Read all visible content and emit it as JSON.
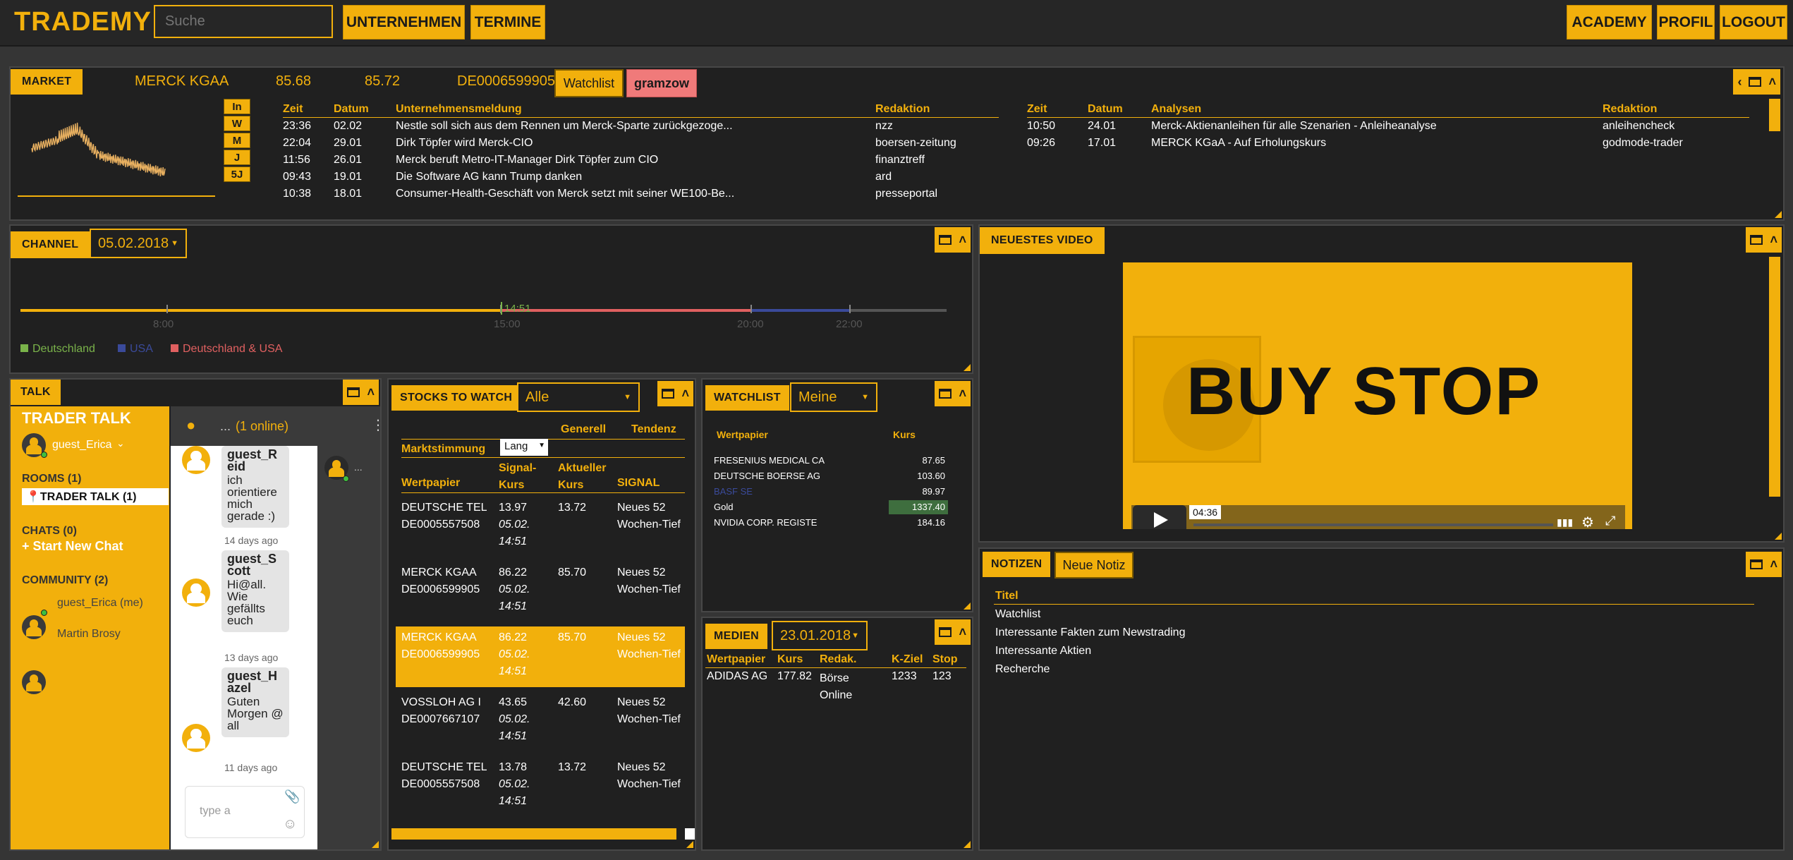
{
  "header": {
    "logo": "TRADEMY",
    "search_placeholder": "Suche",
    "nav_left": [
      "UNTERNEHMEN",
      "TERMINE"
    ],
    "nav_right": [
      "ACADEMY",
      "PROFIL",
      "LOGOUT"
    ]
  },
  "market": {
    "title": "MARKET",
    "name": "MERCK KGAA",
    "price1": "85.68",
    "price2": "85.72",
    "isin": "DE0006599905",
    "watchlist_btn": "Watchlist",
    "user_btn": "gramzow",
    "ranges": [
      "In",
      "W",
      "M",
      "J",
      "5J"
    ],
    "news_headers": [
      "Zeit",
      "Datum",
      "Unternehmensmeldung",
      "Redaktion"
    ],
    "news": [
      [
        "23:36",
        "02.02",
        "Nestle soll sich aus dem Rennen um Merck-Sparte zurückgezoge...",
        "nzz"
      ],
      [
        "22:04",
        "29.01",
        "Dirk Töpfer wird Merck-CIO",
        "boersen-zeitung"
      ],
      [
        "11:56",
        "26.01",
        "Merck beruft Metro-IT-Manager Dirk Töpfer zum CIO",
        "finanztreff"
      ],
      [
        "09:43",
        "19.01",
        "Die Software AG kann Trump danken",
        "ard"
      ],
      [
        "10:38",
        "18.01",
        "Consumer-Health-Geschäft von Merck setzt mit seiner WE100-Be...",
        "presseportal"
      ]
    ],
    "analysis_headers": [
      "Zeit",
      "Datum",
      "Analysen",
      "Redaktion"
    ],
    "analysis": [
      [
        "10:50",
        "24.01",
        "Merck-Aktienanleihen für alle Szenarien - Anleiheanalyse",
        "anleihencheck"
      ],
      [
        "09:26",
        "17.01",
        "MERCK KGaA - Auf Erholungskurs",
        "godmode-trader"
      ]
    ]
  },
  "channel": {
    "title": "CHANNEL",
    "date": "05.02.2018",
    "ticks": [
      "8:00",
      "15:00",
      "20:00",
      "22:00"
    ],
    "now": "14:51",
    "legend": [
      "Deutschland",
      "USA",
      "Deutschland & USA"
    ],
    "colors": {
      "de": "#f2b00c",
      "usa": "#3a4a9a",
      "both": "#e06060"
    }
  },
  "video": {
    "title": "NEUESTES VIDEO",
    "banner": "BUY STOP",
    "time": "04:36"
  },
  "talk": {
    "tab": "TALK",
    "heading": "TRADER TALK",
    "user": "guest_Erica",
    "rooms_label": "ROOMS (1)",
    "room": "TRADER TALK (1)",
    "chats_label": "CHATS (0)",
    "new_chat": "+ Start New Chat",
    "community_label": "COMMUNITY (2)",
    "members": [
      "guest_Erica (me)",
      "Martin Brosy"
    ],
    "online": "(1 online)",
    "ellipsis": "...",
    "messages": [
      {
        "name": "guest_Reid",
        "text": "ich orientiere mich gerade :)",
        "ago": "14 days ago"
      },
      {
        "name": "guest_Scott",
        "text": "Hi@all. Wie gefällts euch",
        "ago": "13 days ago"
      },
      {
        "name": "guest_Hazel",
        "text": "Guten Morgen @ all",
        "ago": "11 days ago"
      }
    ],
    "input_placeholder": "type a"
  },
  "stocks": {
    "title": "STOCKS TO WATCH",
    "filter": "Alle",
    "h_generell": "Generell",
    "h_tendenz": "Tendenz",
    "h_marktstimmung": "Marktstimmung",
    "lang": "Lang",
    "h_wertpapier": "Wertpapier",
    "h_signal_kurs": "Signal-Kurs",
    "h_aktueller_kurs": "Aktueller Kurs",
    "h_signal": "SIGNAL",
    "rows": [
      {
        "name": "DEUTSCHE TEL",
        "isin": "DE0005557508",
        "sig": "13.97",
        "date": "05.02.",
        "time": "14:51",
        "cur": "13.72",
        "signal": "Neues 52 Wochen-Tief",
        "hl": false
      },
      {
        "name": "MERCK KGAA",
        "isin": "DE0006599905",
        "sig": "86.22",
        "date": "05.02.",
        "time": "14:51",
        "cur": "85.70",
        "signal": "Neues 52 Wochen-Tief",
        "hl": false
      },
      {
        "name": "MERCK KGAA",
        "isin": "DE0006599905",
        "sig": "86.22",
        "date": "05.02.",
        "time": "14:51",
        "cur": "85.70",
        "signal": "Neues 52 Wochen-Tief",
        "hl": true
      },
      {
        "name": "VOSSLOH AG I",
        "isin": "DE0007667107",
        "sig": "43.65",
        "date": "05.02.",
        "time": "14:51",
        "cur": "42.60",
        "signal": "Neues 52 Wochen-Tief",
        "hl": false
      },
      {
        "name": "DEUTSCHE TEL",
        "isin": "DE0005557508",
        "sig": "13.78",
        "date": "05.02.",
        "time": "14:51",
        "cur": "13.72",
        "signal": "Neues 52 Wochen-Tief",
        "hl": false
      }
    ]
  },
  "watchlist": {
    "title": "WATCHLIST",
    "filter": "Meine",
    "headers": [
      "Wertpapier",
      "Kurs"
    ],
    "rows": [
      [
        "FRESENIUS MEDICAL CA",
        "87.65"
      ],
      [
        "DEUTSCHE BOERSE AG",
        "103.60"
      ],
      [
        "BASF SE",
        "89.97"
      ],
      [
        "Gold",
        "1337.40"
      ],
      [
        "NVIDIA CORP. REGISTE",
        "184.16"
      ]
    ]
  },
  "medien": {
    "title": "MEDIEN",
    "date": "23.01.2018",
    "headers": [
      "Wertpapier",
      "Kurs",
      "Redak.",
      "K-Ziel",
      "Stop"
    ],
    "row": [
      "ADIDAS AG",
      "177.82",
      "Börse Online",
      "1233",
      "123"
    ]
  },
  "notizen": {
    "title": "NOTIZEN",
    "new_btn": "Neue Notiz",
    "header": "Titel",
    "items": [
      "Watchlist",
      "Interessante Fakten zum Newstrading",
      "Interessante Aktien",
      "Recherche"
    ]
  }
}
